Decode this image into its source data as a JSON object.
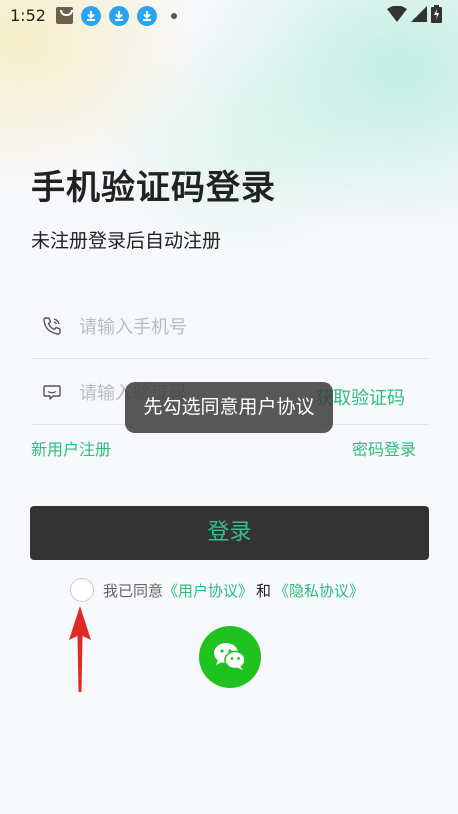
{
  "status_bar": {
    "time": "1:52"
  },
  "header": {
    "title": "手机验证码登录",
    "subtitle": "未注册登录后自动注册"
  },
  "form": {
    "phone_placeholder": "请输入手机号",
    "code_placeholder": "请输入验证码",
    "get_code_label": "获取验证码"
  },
  "links": {
    "register": "新用户注册",
    "password_login": "密码登录"
  },
  "login_button": "登录",
  "agreement": {
    "prefix": "我已同意",
    "user_agreement": "《用户协议》",
    "and": "和",
    "privacy_policy": "《隐私协议》",
    "checked": false
  },
  "toast": "先勾选同意用户协议",
  "colors": {
    "accent_green": "#2dbd7e",
    "button_bg": "#333333",
    "wechat_green": "#1fc21f",
    "arrow_red": "#e02a2a"
  },
  "icons": [
    "bag-icon",
    "download-icon",
    "wifi-icon",
    "signal-icon",
    "battery-icon",
    "phone-icon",
    "message-icon",
    "wechat-icon"
  ]
}
